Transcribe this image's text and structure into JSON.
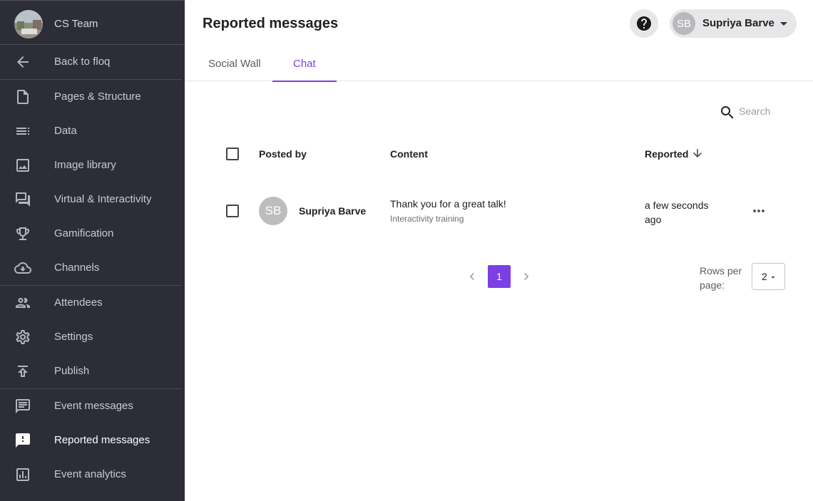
{
  "sidebar": {
    "team_name": "CS Team",
    "back_label": "Back to floq",
    "items": [
      {
        "label": "Pages & Structure",
        "icon": "page-icon"
      },
      {
        "label": "Data",
        "icon": "list-icon"
      },
      {
        "label": "Image library",
        "icon": "image-icon"
      },
      {
        "label": "Virtual & Interactivity",
        "icon": "forum-icon"
      },
      {
        "label": "Gamification",
        "icon": "trophy-icon"
      },
      {
        "label": "Channels",
        "icon": "cloud-download-icon"
      },
      {
        "label": "Attendees",
        "icon": "people-icon"
      },
      {
        "label": "Settings",
        "icon": "gear-icon"
      },
      {
        "label": "Publish",
        "icon": "publish-icon"
      },
      {
        "label": "Event messages",
        "icon": "message-icon"
      },
      {
        "label": "Reported messages",
        "icon": "report-message-icon"
      },
      {
        "label": "Event analytics",
        "icon": "analytics-icon"
      }
    ],
    "active_item": "Reported messages"
  },
  "header": {
    "title": "Reported messages",
    "user": {
      "initials": "SB",
      "name": "Supriya Barve"
    }
  },
  "tabs": [
    {
      "label": "Social Wall",
      "active": false
    },
    {
      "label": "Chat",
      "active": true
    }
  ],
  "search": {
    "placeholder": "Search",
    "value": ""
  },
  "table": {
    "columns": [
      "Posted by",
      "Content",
      "Reported"
    ],
    "sort": {
      "column": "Reported",
      "direction": "descending"
    },
    "rows": [
      {
        "initials": "SB",
        "posted_by": "Supriya Barve",
        "content": "Thank you for a great talk!",
        "sub": "Interactivity training",
        "reported": "a few seconds ago"
      }
    ]
  },
  "pagination": {
    "current_page": "1",
    "rows_per_page_label": "Rows per page:",
    "rows_per_page_value": "2"
  },
  "colors": {
    "accent": "#7b3fe4",
    "sidebar_bg": "#2c2d37"
  }
}
